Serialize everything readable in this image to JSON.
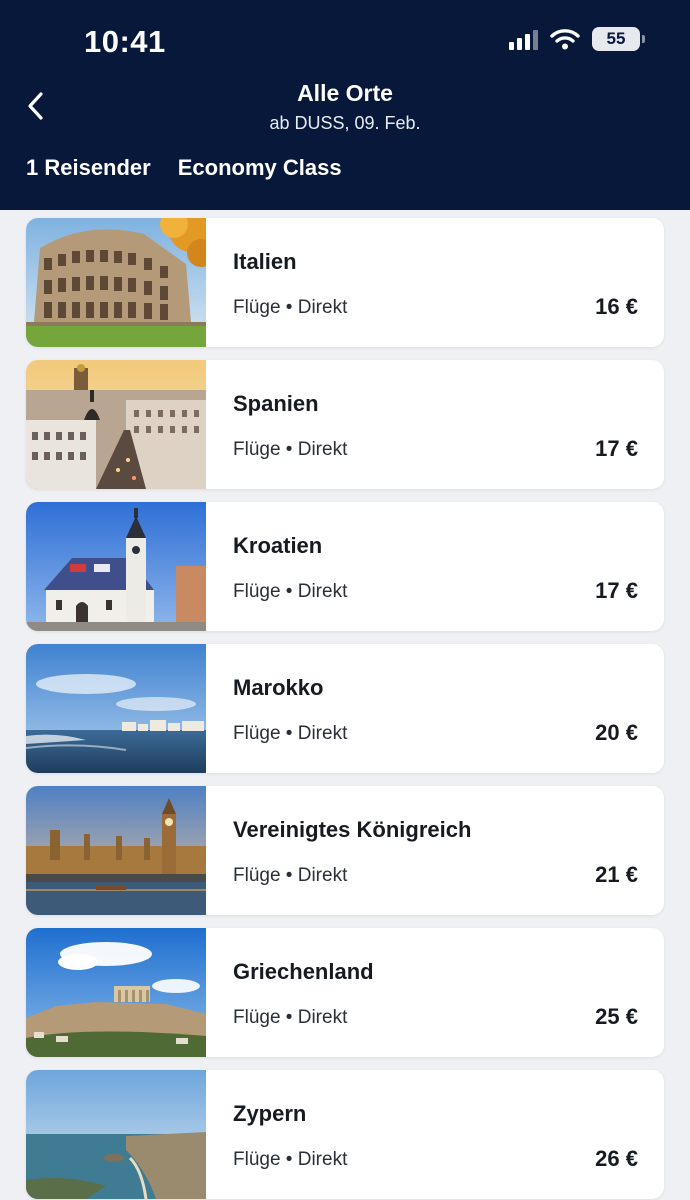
{
  "status_bar": {
    "time": "10:41",
    "battery": "55"
  },
  "header": {
    "title": "Alle Orte",
    "subtitle": "ab DUSS, 09. Feb.",
    "filters": {
      "travelers": "1 Reisender",
      "cabin": "Economy Class"
    }
  },
  "destinations": [
    {
      "name": "Italien",
      "meta": "Flüge • Direkt",
      "price": "16 €"
    },
    {
      "name": "Spanien",
      "meta": "Flüge • Direkt",
      "price": "17 €"
    },
    {
      "name": "Kroatien",
      "meta": "Flüge • Direkt",
      "price": "17 €"
    },
    {
      "name": "Marokko",
      "meta": "Flüge • Direkt",
      "price": "20 €"
    },
    {
      "name": "Vereinigtes Königreich",
      "meta": "Flüge • Direkt",
      "price": "21 €"
    },
    {
      "name": "Griechenland",
      "meta": "Flüge • Direkt",
      "price": "25 €"
    },
    {
      "name": "Zypern",
      "meta": "Flüge • Direkt",
      "price": "26 €"
    }
  ],
  "colors": {
    "header_bg": "#07183a",
    "page_bg": "#eef0f4",
    "card_bg": "#ffffff"
  }
}
